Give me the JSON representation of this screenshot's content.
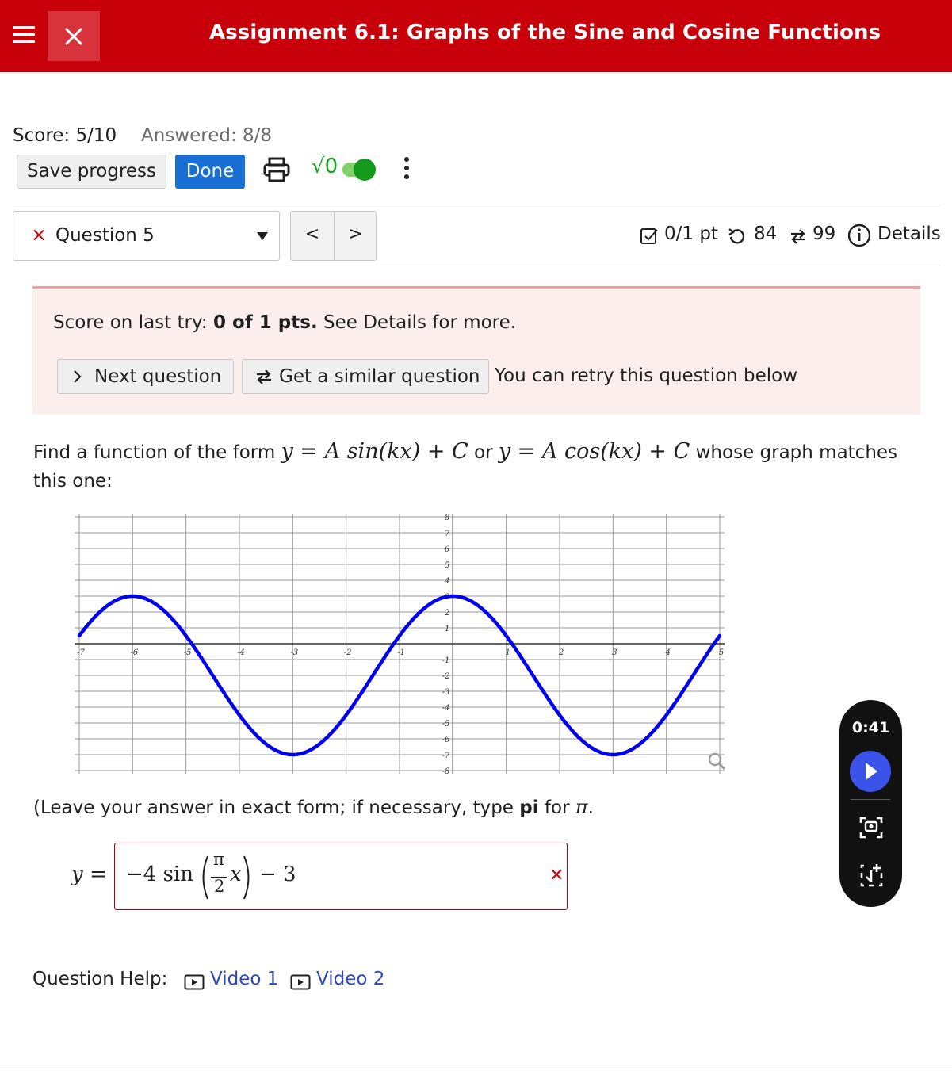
{
  "header": {
    "title": "Assignment 6.1: Graphs of the Sine and Cosine Functions",
    "bg_color": "#c8000a"
  },
  "status": {
    "score": "Score: 5/10",
    "answered": "Answered: 8/8"
  },
  "toolbar": {
    "save_label": "Save progress",
    "done_label": "Done",
    "sqrt_label": "√0",
    "math_toggle_on": true
  },
  "question_nav": {
    "current": "Question 5",
    "status_mark": "×",
    "prev": "<",
    "next": ">"
  },
  "question_meta": {
    "points": "0/1 pt",
    "retries": "84",
    "similar": "99",
    "details": "Details"
  },
  "alert": {
    "prefix": "Score on last try: ",
    "score": "0 of 1 pts.",
    "suffix": " See Details for more.",
    "next_label": "Next question",
    "similar_label": "Get a similar question",
    "retry_text": "You can retry this question below"
  },
  "question": {
    "prompt_start": "Find a function of the form ",
    "or": " or ",
    "prompt_end": " whose graph matches this one:",
    "form1": "y = A sin(kx) + C",
    "form2": "y = A cos(kx) + C",
    "instruction_start": "(Leave your answer in exact form; if necessary, type ",
    "instruction_bold": "pi",
    "instruction_mid": " for ",
    "instruction_pi": "π",
    "instruction_end": "."
  },
  "answer": {
    "lhs": "y =",
    "coef": "−4 sin",
    "frac_num": "π",
    "frac_den": "2",
    "var": "x",
    "tail": "− 3",
    "wrong_mark": "✕"
  },
  "help": {
    "label": "Question Help:",
    "videos": [
      "Video 1",
      "Video 2"
    ]
  },
  "widget": {
    "timer": "0:41",
    "icons": [
      "play-icon",
      "screenshot-icon",
      "bookmark-add-icon"
    ]
  },
  "chart_data": {
    "type": "line",
    "title": "",
    "xlabel": "",
    "ylabel": "",
    "xlim": [
      -7,
      5
    ],
    "ylim": [
      -8,
      8
    ],
    "x_ticks": [
      -7,
      -6,
      -5,
      -4,
      -3,
      -2,
      -1,
      1,
      2,
      3,
      4,
      5
    ],
    "y_ticks": [
      -8,
      -7,
      -6,
      -5,
      -4,
      -3,
      -2,
      -1,
      1,
      2,
      3,
      4,
      5,
      6,
      7,
      8
    ],
    "grid": true,
    "series": [
      {
        "color": "#0000ee",
        "x": [
          -7,
          -6,
          -5,
          -4,
          -3,
          -2,
          -1,
          0,
          1,
          2,
          3,
          4,
          5
        ],
        "values": [
          1,
          3,
          1,
          -3,
          -7,
          -3,
          1,
          3,
          1,
          -3,
          -7,
          -3,
          1
        ]
      }
    ]
  }
}
